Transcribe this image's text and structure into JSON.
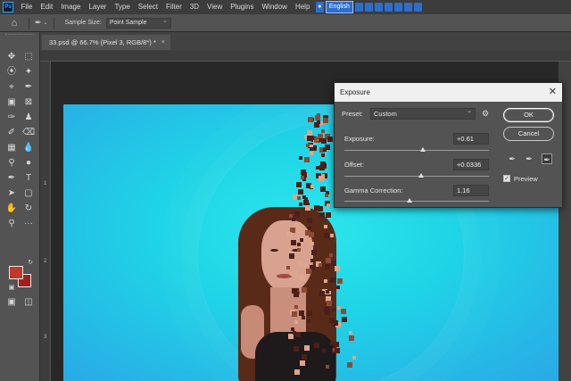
{
  "app": {
    "logo": "Ps"
  },
  "menu": [
    "File",
    "Edit",
    "Image",
    "Layer",
    "Type",
    "Select",
    "Filter",
    "3D",
    "View",
    "Plugins",
    "Window",
    "Help"
  ],
  "ime": {
    "language": "English"
  },
  "options_bar": {
    "sample_size_label": "Sample Size:",
    "sample_size_value": "Point Sample"
  },
  "document": {
    "tab_title": "33.psd @ 66.7% (Pixel 3, RGB/8*) *",
    "close": "×"
  },
  "rulers": {
    "v_marks": [
      "1",
      "2",
      "3"
    ]
  },
  "colors": {
    "foreground": "#c0392b",
    "background": "#a31f1c",
    "canvas_bg": "#2ce7ec"
  },
  "tools": [
    "move-tool-icon",
    "marquee-tool-icon",
    "lasso-tool-icon",
    "magic-wand-icon",
    "crop-tool-icon",
    "eyedropper-icon",
    "spot-healing-icon",
    "brush-icon",
    "clone-stamp-icon",
    "history-brush-icon",
    "eraser-icon",
    "gradient-icon",
    "blur-icon",
    "dodge-icon",
    "pen-icon",
    "type-tool-icon",
    "path-select-icon",
    "rectangle-icon",
    "hand-icon",
    "zoom-icon",
    "edit-toolbar-icon"
  ],
  "exposure_dialog": {
    "title": "Exposure",
    "close": "✕",
    "preset_label": "Preset:",
    "preset_value": "Custom",
    "exposure_label": "Exposure:",
    "exposure_value": "+0.61",
    "offset_label": "Offset:",
    "offset_value": "+0.0336",
    "gamma_label": "Gamma Correction:",
    "gamma_value": "1.16",
    "ok_label": "OK",
    "cancel_label": "Cancel",
    "preview_label": "Preview",
    "preview_checked": true
  }
}
